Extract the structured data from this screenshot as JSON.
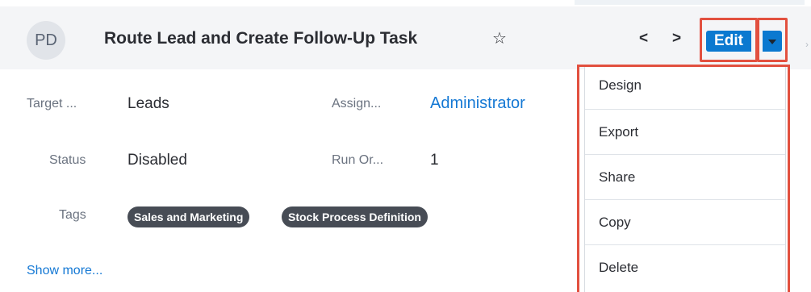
{
  "header": {
    "avatar_initials": "PD",
    "title": "Route Lead and Create Follow-Up Task",
    "edit_label": "Edit"
  },
  "fields": {
    "target_label": "Target ...",
    "target_value": "Leads",
    "assigned_label": "Assign...",
    "assigned_value": "Administrator",
    "status_label": "Status",
    "status_value": "Disabled",
    "run_order_label": "Run Or...",
    "run_order_value": "1",
    "tags_label": "Tags",
    "tags": [
      "Sales and Marketing",
      "Stock Process Definition"
    ]
  },
  "show_more_label": "Show more...",
  "actions_menu": {
    "items": [
      {
        "label": "Design"
      },
      {
        "label": "Export"
      },
      {
        "label": "Share"
      },
      {
        "label": "Copy"
      },
      {
        "label": "Delete"
      }
    ]
  },
  "colors": {
    "accent": "#0b79d0",
    "highlight_outline": "#e2503f",
    "link": "#1478d4",
    "tag_background": "#474c55"
  }
}
